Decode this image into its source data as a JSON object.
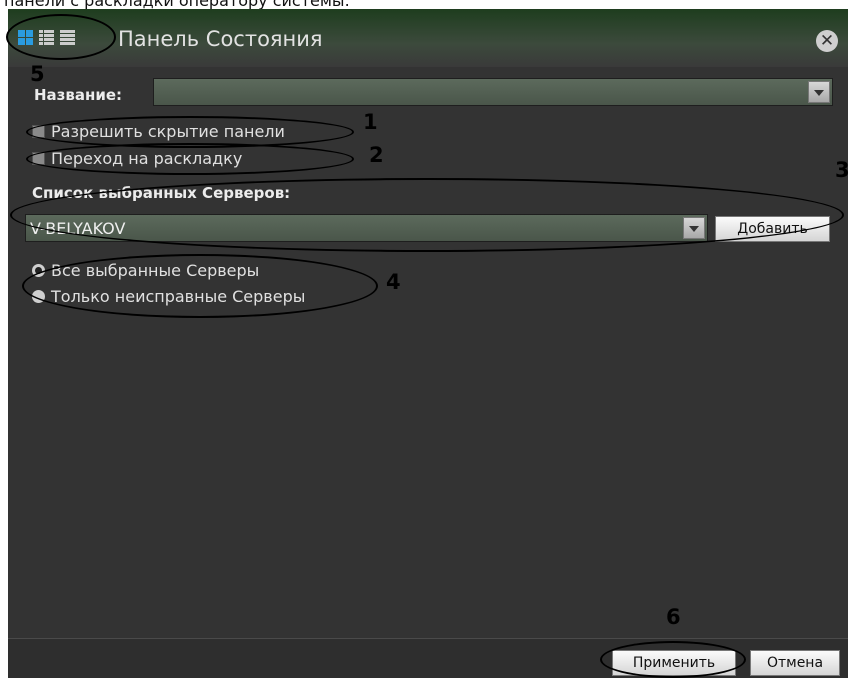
{
  "caption": "панели с раскладки оператору системы.",
  "window": {
    "title": "Панель Состояния"
  },
  "view_icons": [
    "tiles-view-icon",
    "detail-list-icon",
    "list-icon"
  ],
  "form": {
    "name_label": "Название:",
    "name_value": "",
    "allow_hide_label": "Разрешить скрытие панели",
    "goto_layout_label": "Переход на раскладку",
    "servers_label": "Список выбранных Серверов:",
    "server_selected": "V-BELYAKOV",
    "add_button": "Добавить",
    "radio_all": "Все выбранные Серверы",
    "radio_faulty": "Только неисправные Серверы",
    "radio_selected": "all"
  },
  "footer": {
    "apply": "Применить",
    "cancel": "Отмена"
  },
  "annotations": [
    "1",
    "2",
    "3",
    "4",
    "5",
    "6"
  ]
}
